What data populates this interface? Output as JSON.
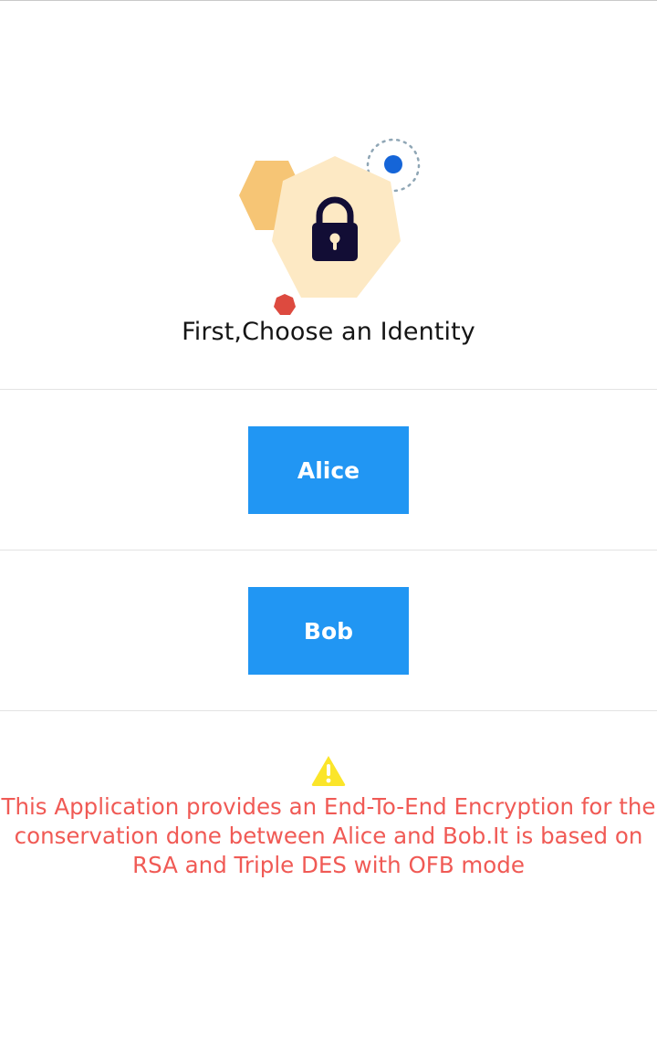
{
  "heading": {
    "text": "First,Choose an Identity"
  },
  "identities": [
    {
      "label": "Alice"
    },
    {
      "label": "Bob"
    }
  ],
  "notice": {
    "icon": "warning-icon",
    "text": "This Application provides an End-To-End Encryption for the conservation done between Alice and Bob.It is based on RSA and Triple DES with OFB mode"
  },
  "colors": {
    "button": "#2196f3",
    "notice_text": "#f05a55",
    "warning_icon": "#fbe52a",
    "lock_hexagon": "#fde9c4",
    "accent_hexagon": "#f5c26e",
    "dot_blue": "#1565d8",
    "dot_red": "#dd4a3f"
  }
}
